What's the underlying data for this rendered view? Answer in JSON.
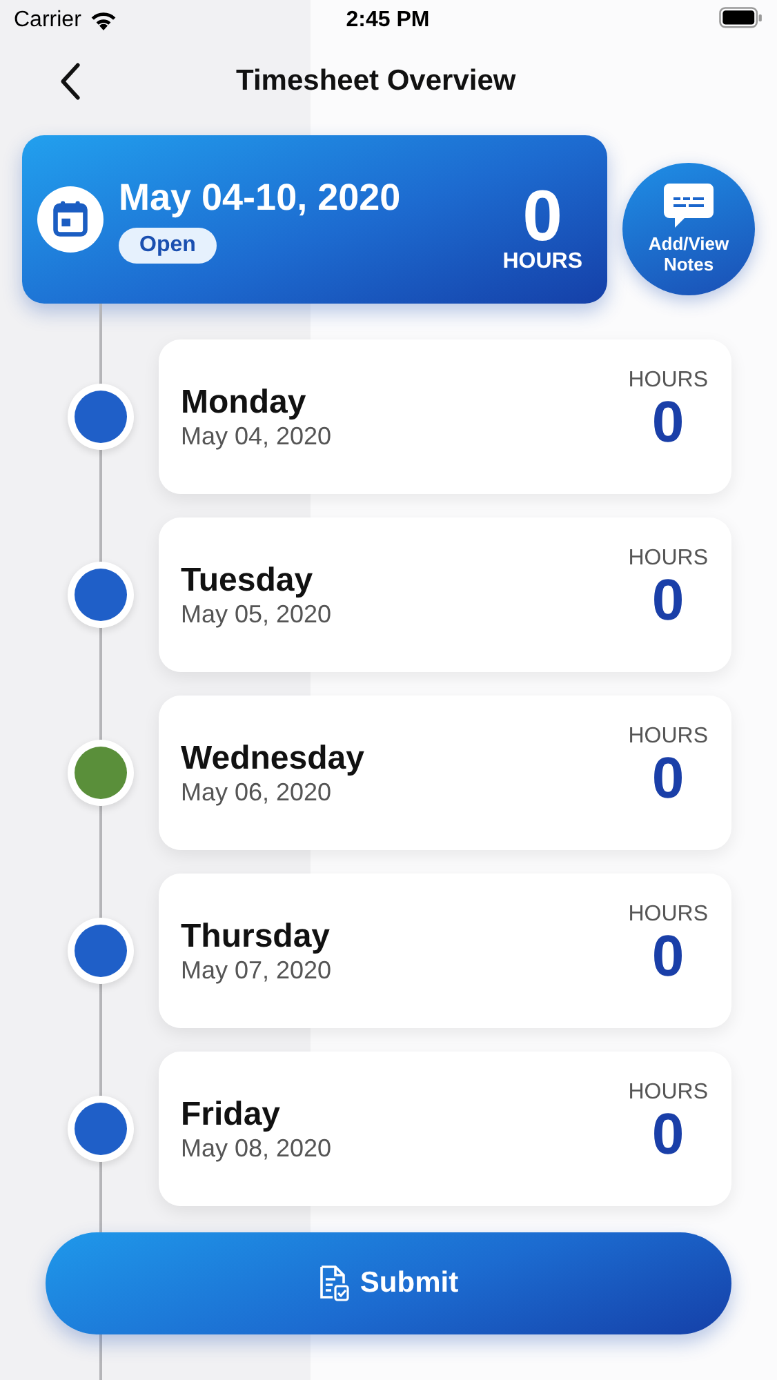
{
  "status_bar": {
    "carrier": "Carrier",
    "time": "2:45 PM"
  },
  "nav": {
    "title": "Timesheet Overview"
  },
  "week": {
    "range": "May 04-10, 2020",
    "status": "Open",
    "hours": "0",
    "hours_label": "HOURS"
  },
  "notes_button": {
    "label": "Add/View Notes"
  },
  "days": [
    {
      "day": "Monday",
      "date": "May 04, 2020",
      "hours_label": "HOURS",
      "hours": "0",
      "color": "#1f5fc8"
    },
    {
      "day": "Tuesday",
      "date": "May 05, 2020",
      "hours_label": "HOURS",
      "hours": "0",
      "color": "#1f5fc8"
    },
    {
      "day": "Wednesday",
      "date": "May 06, 2020",
      "hours_label": "HOURS",
      "hours": "0",
      "color": "#5a8f3a"
    },
    {
      "day": "Thursday",
      "date": "May 07, 2020",
      "hours_label": "HOURS",
      "hours": "0",
      "color": "#1f5fc8"
    },
    {
      "day": "Friday",
      "date": "May 08, 2020",
      "hours_label": "HOURS",
      "hours": "0",
      "color": "#1f5fc8"
    }
  ],
  "submit_button": {
    "label": "Submit"
  }
}
